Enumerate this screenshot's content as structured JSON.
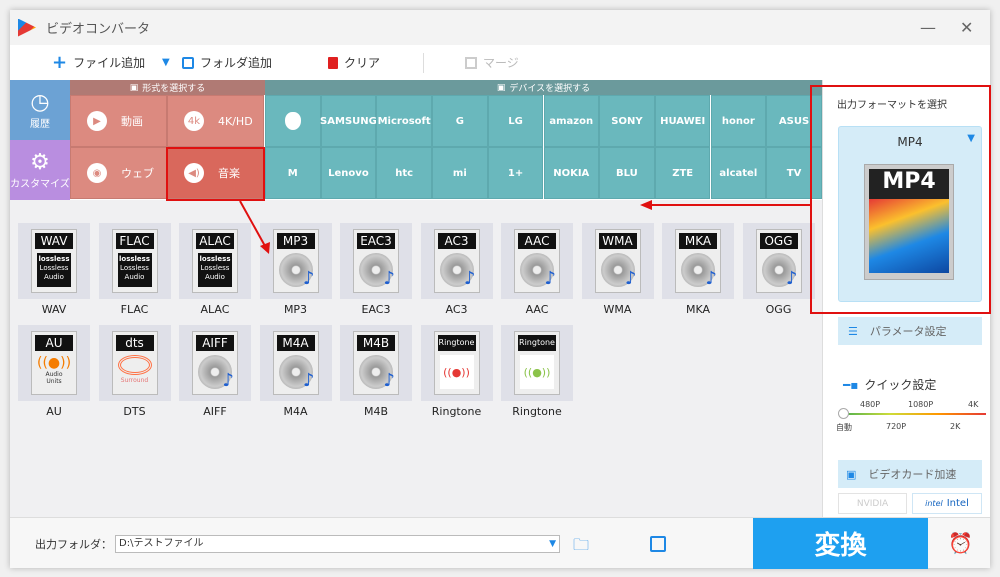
{
  "window": {
    "title": "ビデオコンバータ"
  },
  "toolbar": {
    "add_file": "ファイル追加",
    "add_folder": "フォルダ追加",
    "clear": "クリア",
    "merge": "マージ"
  },
  "categories": {
    "format_header": "形式を選択する",
    "device_header": "デバイスを選択する",
    "history": "履歴",
    "customize": "カスタマイズ",
    "formats": [
      {
        "label": "動画",
        "icon": "play-icon"
      },
      {
        "label": "4K/HD",
        "icon": "4k-icon"
      },
      {
        "label": "ウェブ",
        "icon": "chrome-icon"
      },
      {
        "label": "音楽",
        "icon": "speaker-icon"
      }
    ],
    "devices": [
      "",
      "SAMSUNG",
      "Microsoft",
      "G",
      "LG",
      "amazon",
      "SONY",
      "HUAWEI",
      "honor",
      "ASUS",
      "M",
      "Lenovo",
      "htc",
      "mi",
      "1+",
      "NOKIA",
      "BLU",
      "ZTE",
      "alcatel",
      "TV"
    ],
    "device_names": [
      "apple",
      "samsung",
      "microsoft",
      "google",
      "lg",
      "amazon",
      "sony",
      "huawei",
      "honor",
      "asus",
      "motorola",
      "lenovo",
      "htc",
      "xiaomi",
      "oneplus",
      "nokia",
      "blu",
      "zte",
      "alcatel",
      "tv"
    ]
  },
  "audio_formats": [
    {
      "name": "WAV",
      "badge": "WAV",
      "art": "lossless"
    },
    {
      "name": "FLAC",
      "badge": "FLAC",
      "art": "lossless"
    },
    {
      "name": "ALAC",
      "badge": "ALAC",
      "art": "lossless"
    },
    {
      "name": "MP3",
      "badge": "MP3",
      "art": "disc"
    },
    {
      "name": "EAC3",
      "badge": "EAC3",
      "art": "disc"
    },
    {
      "name": "AC3",
      "badge": "AC3",
      "art": "disc"
    },
    {
      "name": "AAC",
      "badge": "AAC",
      "art": "disc"
    },
    {
      "name": "WMA",
      "badge": "WMA",
      "art": "disc"
    },
    {
      "name": "MKA",
      "badge": "MKA",
      "art": "disc"
    },
    {
      "name": "OGG",
      "badge": "OGG",
      "art": "disc"
    },
    {
      "name": "AU",
      "badge": "AU",
      "art": "au"
    },
    {
      "name": "DTS",
      "badge": "dts",
      "art": "dts"
    },
    {
      "name": "AIFF",
      "badge": "AIFF",
      "art": "disc"
    },
    {
      "name": "M4A",
      "badge": "M4A",
      "art": "disc"
    },
    {
      "name": "M4B",
      "badge": "M4B",
      "art": "disc"
    },
    {
      "name": "Ringtone",
      "badge": "Ringtone",
      "art": "apple"
    },
    {
      "name": "Ringtone",
      "badge": "Ringtone",
      "art": "android"
    }
  ],
  "lossless_text": "Lossless Audio",
  "lossless_logo": "lossless",
  "au_text": "Audio Units",
  "dts_text": "Surround",
  "right": {
    "title": "出力フォーマットを選択",
    "format": "MP4",
    "format_badge": "MP4",
    "params": "パラメータ設定",
    "quick": "クイック設定",
    "ticks_top": [
      "480P",
      "1080P",
      "4K"
    ],
    "ticks_bottom": [
      "自動",
      "720P",
      "2K"
    ],
    "quality_value": "自動",
    "gpu": "ビデオカード加速",
    "nvidia": "NVIDIA",
    "intel": "Intel"
  },
  "bottom": {
    "folder_label": "出力フォルダ：",
    "folder_value": "D:\\テストファイル",
    "convert": "変換"
  },
  "colors": {
    "accent": "#1ea0f0",
    "format_bg": "#dc8a80",
    "device_bg": "#6ab8bd",
    "highlight": "#e01010"
  }
}
